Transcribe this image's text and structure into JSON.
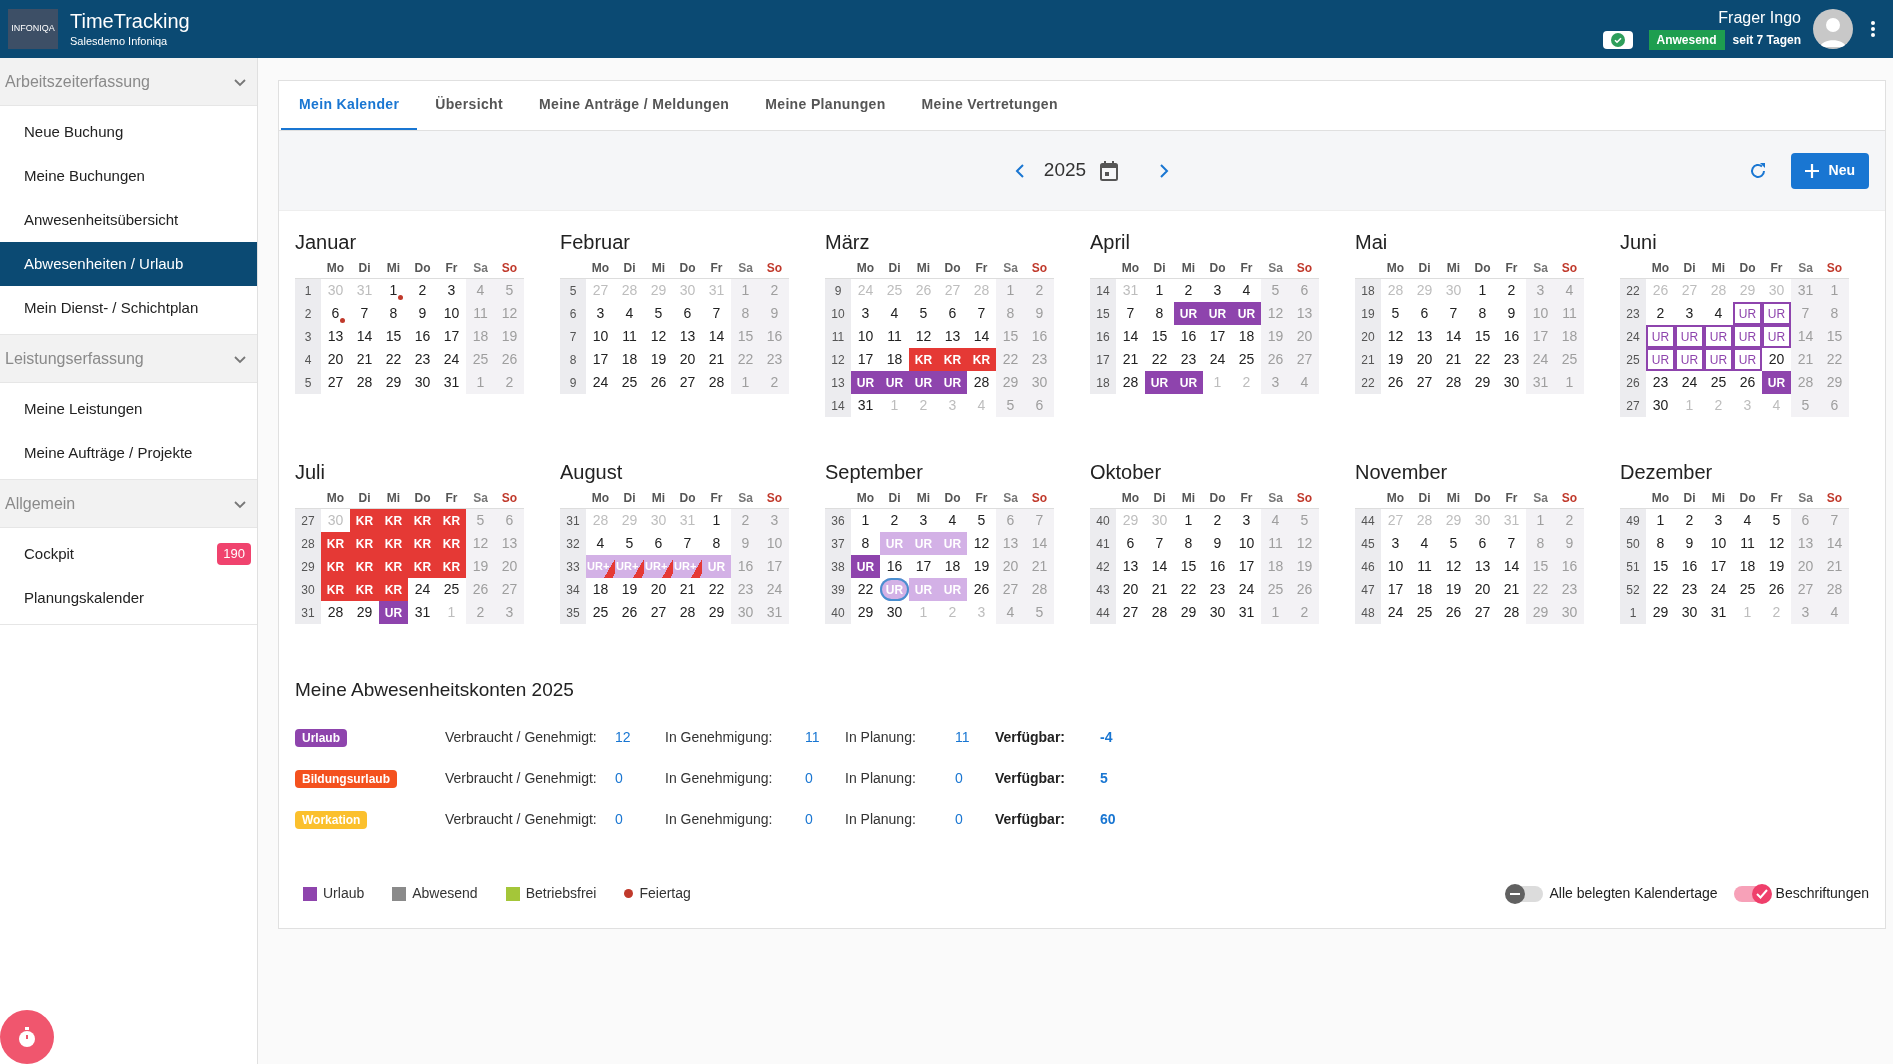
{
  "header": {
    "logo": "INFONIQA",
    "title": "TimeTracking",
    "subtitle": "Salesdemo Infoniqa",
    "status": "Anwesend",
    "since": "seit 7 Tagen",
    "user": "Frager Ingo"
  },
  "sidebar": {
    "sections": [
      {
        "title": "Arbeitszeiterfassung",
        "expanded": true,
        "items": [
          {
            "label": "Neue Buchung",
            "selected": false
          },
          {
            "label": "Meine Buchungen",
            "selected": false
          },
          {
            "label": "Anwesenheitsübersicht",
            "selected": false
          },
          {
            "label": "Abwesenheiten / Urlaub",
            "selected": true
          },
          {
            "label": "Mein Dienst- / Schichtplan",
            "selected": false
          }
        ]
      },
      {
        "title": "Leistungserfassung",
        "expanded": true,
        "items": [
          {
            "label": "Meine Leistungen",
            "selected": false
          },
          {
            "label": "Meine Aufträge / Projekte",
            "selected": false
          }
        ]
      },
      {
        "title": "Allgemein",
        "expanded": true,
        "items": [
          {
            "label": "Cockpit",
            "selected": false,
            "badge": "190"
          },
          {
            "label": "Planungskalender",
            "selected": false
          }
        ]
      }
    ]
  },
  "tabs": [
    {
      "label": "Mein Kalender",
      "selected": true
    },
    {
      "label": "Übersicht",
      "selected": false
    },
    {
      "label": "Meine Anträge / Meldungen",
      "selected": false
    },
    {
      "label": "Meine Planungen",
      "selected": false
    },
    {
      "label": "Meine Vertretungen",
      "selected": false
    }
  ],
  "toolbar": {
    "year": "2025",
    "new_button": "Neu"
  },
  "months": [
    {
      "name": "Januar",
      "weekdays": [
        "Mo",
        "Di",
        "Mi",
        "Do",
        "Fr",
        "Sa",
        "So"
      ],
      "weeks": [
        {
          "week": "1",
          "days": [
            {
              "text": "30",
              "outside": true
            },
            {
              "text": "31",
              "outside": true
            },
            {
              "text": "1",
              "holiday": true
            },
            "2",
            "3",
            "4",
            "5"
          ]
        },
        {
          "week": "2",
          "days": [
            {
              "text": "6",
              "holiday": true
            },
            "7",
            "8",
            "9",
            "10",
            "11",
            "12"
          ]
        },
        {
          "week": "3",
          "days": [
            "13",
            "14",
            "15",
            "16",
            "17",
            "18",
            "19"
          ]
        },
        {
          "week": "4",
          "days": [
            "20",
            "21",
            "22",
            "23",
            "24",
            "25",
            "26"
          ]
        },
        {
          "week": "5",
          "days": [
            "27",
            "28",
            "29",
            "30",
            "31",
            "1",
            "2"
          ]
        }
      ]
    },
    {
      "name": "Februar",
      "weekdays": [
        "Mo",
        "Di",
        "Mi",
        "Do",
        "Fr",
        "Sa",
        "So"
      ],
      "weeks": [
        {
          "week": "5",
          "days": [
            {
              "text": "27",
              "outside": true
            },
            {
              "text": "28",
              "outside": true
            },
            {
              "text": "29",
              "outside": true
            },
            {
              "text": "30",
              "outside": true
            },
            {
              "text": "31",
              "outside": true
            },
            "1",
            "2"
          ]
        },
        {
          "week": "6",
          "days": [
            "3",
            "4",
            "5",
            "6",
            "7",
            "8",
            "9"
          ]
        },
        {
          "week": "7",
          "days": [
            "10",
            "11",
            "12",
            "13",
            "14",
            "15",
            "16"
          ]
        },
        {
          "week": "8",
          "days": [
            "17",
            "18",
            "19",
            "20",
            "21",
            "22",
            "23"
          ]
        },
        {
          "week": "9",
          "days": [
            "24",
            "25",
            "26",
            "27",
            "28",
            "1",
            "2"
          ]
        }
      ]
    },
    {
      "name": "März",
      "weekdays": [
        "Mo",
        "Di",
        "Mi",
        "Do",
        "Fr",
        "Sa",
        "So"
      ],
      "weeks": [
        {
          "week": "9",
          "days": [
            {
              "text": "24",
              "outside": true
            },
            {
              "text": "25",
              "outside": true
            },
            {
              "text": "26",
              "outside": true
            },
            {
              "text": "27",
              "outside": true
            },
            {
              "text": "28",
              "outside": true
            },
            "1",
            "2"
          ]
        },
        {
          "week": "10",
          "days": [
            "3",
            "4",
            "5",
            "6",
            "7",
            "8",
            "9"
          ]
        },
        {
          "week": "11",
          "days": [
            "10",
            "11",
            "12",
            "13",
            "14",
            "15",
            "16"
          ]
        },
        {
          "week": "12",
          "days": [
            "17",
            "18",
            {
              "text": "KR",
              "kind": "sick"
            },
            {
              "text": "KR",
              "kind": "sick"
            },
            {
              "text": "KR",
              "kind": "sick"
            },
            "22",
            "23"
          ]
        },
        {
          "week": "13",
          "days": [
            {
              "text": "UR",
              "kind": "vacation"
            },
            {
              "text": "UR",
              "kind": "vacation"
            },
            {
              "text": "UR",
              "kind": "vacation"
            },
            {
              "text": "UR",
              "kind": "vacation"
            },
            "28",
            "29",
            "30"
          ]
        },
        {
          "week": "14",
          "days": [
            "31",
            {
              "text": "1",
              "outside": true
            },
            {
              "text": "2",
              "outside": true
            },
            {
              "text": "3",
              "outside": true
            },
            {
              "text": "4",
              "outside": true
            },
            "5",
            "6"
          ]
        }
      ]
    },
    {
      "name": "April",
      "weekdays": [
        "Mo",
        "Di",
        "Mi",
        "Do",
        "Fr",
        "Sa",
        "So"
      ],
      "weeks": [
        {
          "week": "14",
          "days": [
            {
              "text": "31",
              "outside": true
            },
            "1",
            "2",
            "3",
            "4",
            "5",
            "6"
          ]
        },
        {
          "week": "15",
          "days": [
            "7",
            "8",
            {
              "text": "UR",
              "kind": "vacation"
            },
            {
              "text": "UR",
              "kind": "vacation"
            },
            {
              "text": "UR",
              "kind": "vacation"
            },
            "12",
            "13"
          ]
        },
        {
          "week": "16",
          "days": [
            "14",
            "15",
            "16",
            "17",
            "18",
            "19",
            "20"
          ]
        },
        {
          "week": "17",
          "days": [
            "21",
            "22",
            "23",
            "24",
            "25",
            "26",
            "27"
          ]
        },
        {
          "week": "18",
          "days": [
            "28",
            {
              "text": "UR",
              "kind": "vacation"
            },
            {
              "text": "UR",
              "kind": "vacation"
            },
            {
              "text": "1",
              "outside": true
            },
            {
              "text": "2",
              "outside": true
            },
            "3",
            "4"
          ]
        }
      ]
    },
    {
      "name": "Mai",
      "weekdays": [
        "Mo",
        "Di",
        "Mi",
        "Do",
        "Fr",
        "Sa",
        "So"
      ],
      "weeks": [
        {
          "week": "18",
          "days": [
            {
              "text": "28",
              "outside": true
            },
            {
              "text": "29",
              "outside": true
            },
            {
              "text": "30",
              "outside": true
            },
            "1",
            "2",
            "3",
            "4"
          ]
        },
        {
          "week": "19",
          "days": [
            "5",
            "6",
            "7",
            "8",
            "9",
            "10",
            "11"
          ]
        },
        {
          "week": "20",
          "days": [
            "12",
            "13",
            "14",
            "15",
            "16",
            "17",
            "18"
          ]
        },
        {
          "week": "21",
          "days": [
            "19",
            "20",
            "21",
            "22",
            "23",
            "24",
            "25"
          ]
        },
        {
          "week": "22",
          "days": [
            "26",
            "27",
            "28",
            "29",
            "30",
            "31",
            "1"
          ]
        }
      ]
    },
    {
      "name": "Juni",
      "weekdays": [
        "Mo",
        "Di",
        "Mi",
        "Do",
        "Fr",
        "Sa",
        "So"
      ],
      "weeks": [
        {
          "week": "22",
          "days": [
            {
              "text": "26",
              "outside": true
            },
            {
              "text": "27",
              "outside": true
            },
            {
              "text": "28",
              "outside": true
            },
            {
              "text": "29",
              "outside": true
            },
            {
              "text": "30",
              "outside": true
            },
            "31",
            "1"
          ]
        },
        {
          "week": "23",
          "days": [
            "2",
            "3",
            "4",
            {
              "text": "UR",
              "kind": "planned"
            },
            {
              "text": "UR",
              "kind": "planned"
            },
            "7",
            "8"
          ]
        },
        {
          "week": "24",
          "days": [
            {
              "text": "UR",
              "kind": "planned"
            },
            {
              "text": "UR",
              "kind": "planned"
            },
            {
              "text": "UR",
              "kind": "planned"
            },
            {
              "text": "UR",
              "kind": "planned"
            },
            {
              "text": "UR",
              "kind": "planned"
            },
            "14",
            "15"
          ]
        },
        {
          "week": "25",
          "days": [
            {
              "text": "UR",
              "kind": "planned"
            },
            {
              "text": "UR",
              "kind": "planned"
            },
            {
              "text": "UR",
              "kind": "planned"
            },
            {
              "text": "UR",
              "kind": "planned"
            },
            "20",
            "21",
            "22"
          ]
        },
        {
          "week": "26",
          "days": [
            "23",
            "24",
            "25",
            "26",
            {
              "text": "UR",
              "kind": "vacation"
            },
            "28",
            "29"
          ]
        },
        {
          "week": "27",
          "days": [
            "30",
            {
              "text": "1",
              "outside": true
            },
            {
              "text": "2",
              "outside": true
            },
            {
              "text": "3",
              "outside": true
            },
            {
              "text": "4",
              "outside": true
            },
            "5",
            "6"
          ]
        }
      ]
    },
    {
      "name": "Juli",
      "weekdays": [
        "Mo",
        "Di",
        "Mi",
        "Do",
        "Fr",
        "Sa",
        "So"
      ],
      "weeks": [
        {
          "week": "27",
          "days": [
            {
              "text": "30",
              "outside": true
            },
            {
              "text": "KR",
              "kind": "sick"
            },
            {
              "text": "KR",
              "kind": "sick"
            },
            {
              "text": "KR",
              "kind": "sick"
            },
            {
              "text": "KR",
              "kind": "sick"
            },
            "5",
            "6"
          ]
        },
        {
          "week": "28",
          "days": [
            {
              "text": "KR",
              "kind": "sick"
            },
            {
              "text": "KR",
              "kind": "sick"
            },
            {
              "text": "KR",
              "kind": "sick"
            },
            {
              "text": "KR",
              "kind": "sick"
            },
            {
              "text": "KR",
              "kind": "sick"
            },
            "12",
            "13"
          ]
        },
        {
          "week": "29",
          "days": [
            {
              "text": "KR",
              "kind": "sick"
            },
            {
              "text": "KR",
              "kind": "sick"
            },
            {
              "text": "KR",
              "kind": "sick"
            },
            {
              "text": "KR",
              "kind": "sick"
            },
            {
              "text": "KR",
              "kind": "sick"
            },
            "19",
            "20"
          ]
        },
        {
          "week": "30",
          "days": [
            {
              "text": "KR",
              "kind": "sick"
            },
            {
              "text": "KR",
              "kind": "sick"
            },
            {
              "text": "KR",
              "kind": "sick"
            },
            "24",
            "25",
            "26",
            "27"
          ]
        },
        {
          "week": "31",
          "days": [
            "28",
            "29",
            {
              "text": "UR",
              "kind": "vacation"
            },
            "31",
            {
              "text": "1",
              "outside": true
            },
            "2",
            "3"
          ]
        }
      ]
    },
    {
      "name": "August",
      "weekdays": [
        "Mo",
        "Di",
        "Mi",
        "Do",
        "Fr",
        "Sa",
        "So"
      ],
      "weeks": [
        {
          "week": "31",
          "days": [
            {
              "text": "28",
              "outside": true
            },
            {
              "text": "29",
              "outside": true
            },
            {
              "text": "30",
              "outside": true
            },
            {
              "text": "31",
              "outside": true
            },
            "1",
            "2",
            "3"
          ]
        },
        {
          "week": "32",
          "days": [
            "4",
            "5",
            "6",
            "7",
            "8",
            "9",
            "10"
          ]
        },
        {
          "week": "33",
          "days": [
            {
              "text": "UR+",
              "kind": "mixed"
            },
            {
              "text": "UR+",
              "kind": "mixed"
            },
            {
              "text": "UR+",
              "kind": "mixed"
            },
            {
              "text": "UR+",
              "kind": "mixed"
            },
            {
              "text": "UR",
              "kind": "requested"
            },
            "16",
            "17"
          ]
        },
        {
          "week": "34",
          "days": [
            "18",
            "19",
            "20",
            "21",
            "22",
            "23",
            "24"
          ]
        },
        {
          "week": "35",
          "days": [
            "25",
            "26",
            "27",
            "28",
            "29",
            "30",
            "31"
          ]
        }
      ]
    },
    {
      "name": "September",
      "weekdays": [
        "Mo",
        "Di",
        "Mi",
        "Do",
        "Fr",
        "Sa",
        "So"
      ],
      "weeks": [
        {
          "week": "36",
          "days": [
            "1",
            "2",
            "3",
            "4",
            "5",
            "6",
            "7"
          ]
        },
        {
          "week": "37",
          "days": [
            "8",
            {
              "text": "UR",
              "kind": "requested"
            },
            {
              "text": "UR",
              "kind": "requested"
            },
            {
              "text": "UR",
              "kind": "requested"
            },
            "12",
            "13",
            "14"
          ]
        },
        {
          "week": "38",
          "days": [
            {
              "text": "UR",
              "kind": "vacation"
            },
            "16",
            "17",
            "18",
            "19",
            "20",
            "21"
          ]
        },
        {
          "week": "39",
          "days": [
            "22",
            {
              "text": "UR",
              "kind": "requested",
              "today": true
            },
            {
              "text": "UR",
              "kind": "requested"
            },
            {
              "text": "UR",
              "kind": "requested"
            },
            "26",
            "27",
            "28"
          ]
        },
        {
          "week": "40",
          "days": [
            "29",
            "30",
            {
              "text": "1",
              "outside": true
            },
            {
              "text": "2",
              "outside": true
            },
            {
              "text": "3",
              "outside": true
            },
            "4",
            "5"
          ]
        }
      ]
    },
    {
      "name": "Oktober",
      "weekdays": [
        "Mo",
        "Di",
        "Mi",
        "Do",
        "Fr",
        "Sa",
        "So"
      ],
      "weeks": [
        {
          "week": "40",
          "days": [
            {
              "text": "29",
              "outside": true
            },
            {
              "text": "30",
              "outside": true
            },
            "1",
            "2",
            "3",
            "4",
            "5"
          ]
        },
        {
          "week": "41",
          "days": [
            "6",
            "7",
            "8",
            "9",
            "10",
            "11",
            "12"
          ]
        },
        {
          "week": "42",
          "days": [
            "13",
            "14",
            "15",
            "16",
            "17",
            "18",
            "19"
          ]
        },
        {
          "week": "43",
          "days": [
            "20",
            "21",
            "22",
            "23",
            "24",
            "25",
            "26"
          ]
        },
        {
          "week": "44",
          "days": [
            "27",
            "28",
            "29",
            "30",
            "31",
            "1",
            "2"
          ]
        }
      ]
    },
    {
      "name": "November",
      "weekdays": [
        "Mo",
        "Di",
        "Mi",
        "Do",
        "Fr",
        "Sa",
        "So"
      ],
      "weeks": [
        {
          "week": "44",
          "days": [
            {
              "text": "27",
              "outside": true
            },
            {
              "text": "28",
              "outside": true
            },
            {
              "text": "29",
              "outside": true
            },
            {
              "text": "30",
              "outside": true
            },
            {
              "text": "31",
              "outside": true
            },
            "1",
            "2"
          ]
        },
        {
          "week": "45",
          "days": [
            "3",
            "4",
            "5",
            "6",
            "7",
            "8",
            "9"
          ]
        },
        {
          "week": "46",
          "days": [
            "10",
            "11",
            "12",
            "13",
            "14",
            "15",
            "16"
          ]
        },
        {
          "week": "47",
          "days": [
            "17",
            "18",
            "19",
            "20",
            "21",
            "22",
            "23"
          ]
        },
        {
          "week": "48",
          "days": [
            "24",
            "25",
            "26",
            "27",
            "28",
            "29",
            "30"
          ]
        }
      ]
    },
    {
      "name": "Dezember",
      "weekdays": [
        "Mo",
        "Di",
        "Mi",
        "Do",
        "Fr",
        "Sa",
        "So"
      ],
      "weeks": [
        {
          "week": "49",
          "days": [
            "1",
            "2",
            "3",
            "4",
            "5",
            "6",
            "7"
          ]
        },
        {
          "week": "50",
          "days": [
            "8",
            "9",
            "10",
            "11",
            "12",
            "13",
            "14"
          ]
        },
        {
          "week": "51",
          "days": [
            "15",
            "16",
            "17",
            "18",
            "19",
            "20",
            "21"
          ]
        },
        {
          "week": "52",
          "days": [
            "22",
            "23",
            "24",
            "25",
            "26",
            "27",
            "28"
          ]
        },
        {
          "week": "1",
          "days": [
            "29",
            "30",
            "31",
            {
              "text": "1",
              "outside": true
            },
            {
              "text": "2",
              "outside": true
            },
            "3",
            "4"
          ]
        }
      ]
    }
  ],
  "accounts": {
    "title": "Meine Abwesenheitskonten 2025",
    "rows": [
      {
        "name": "Urlaub",
        "color": "#8e44ad",
        "used_label": "Verbraucht / Genehmigt:",
        "used": "12",
        "pending_label": "In Genehmigung:",
        "pending": "11",
        "planned_label": "In Planung:",
        "planned": "11",
        "available_label": "Verfügbar:",
        "available": "-4"
      },
      {
        "name": "Bildungsurlaub",
        "color": "#f4511e",
        "used_label": "Verbraucht / Genehmigt:",
        "used": "0",
        "pending_label": "In Genehmigung:",
        "pending": "0",
        "planned_label": "In Planung:",
        "planned": "0",
        "available_label": "Verfügbar:",
        "available": "5"
      },
      {
        "name": "Workation",
        "color": "#fbc02d",
        "used_label": "Verbraucht / Genehmigt:",
        "used": "0",
        "pending_label": "In Genehmigung:",
        "pending": "0",
        "planned_label": "In Planung:",
        "planned": "0",
        "available_label": "Verfügbar:",
        "available": "60"
      }
    ]
  },
  "legend": [
    {
      "label": "Urlaub",
      "color": "#8e44ad",
      "kind": "square"
    },
    {
      "label": "Abwesend",
      "color": "#8a8a8a",
      "kind": "square"
    },
    {
      "label": "Betriebsfrei",
      "color": "#a4c639",
      "kind": "square"
    },
    {
      "label": "Feiertag",
      "color": "#c0392b",
      "kind": "dot"
    }
  ],
  "toggles": [
    {
      "label": "Alle belegten Kalendertage",
      "on": false
    },
    {
      "label": "Beschriftungen",
      "on": true
    }
  ]
}
